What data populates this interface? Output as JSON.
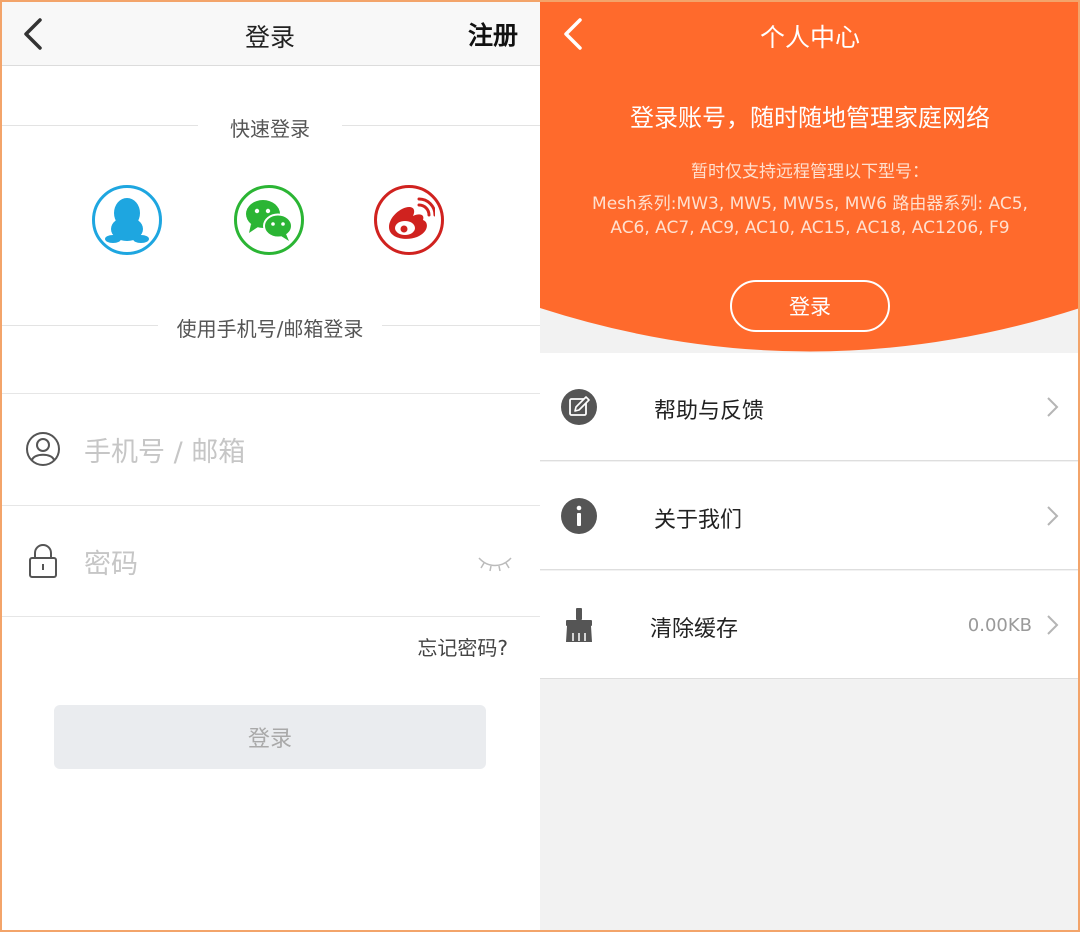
{
  "login_screen": {
    "title": "登录",
    "register_label": "注册",
    "quick_login_label": "快速登录",
    "social_icons": [
      "qq-icon",
      "wechat-icon",
      "weibo-icon"
    ],
    "phone_login_label": "使用手机号/邮箱登录",
    "phone_placeholder": "手机号 / 邮箱",
    "password_placeholder": "密码",
    "forgot_label": "忘记密码?",
    "login_button": "登录",
    "colors": {
      "qq": "#1ea6e0",
      "wechat": "#2bb534",
      "weibo": "#d0221f",
      "button_bg": "#eaecef"
    }
  },
  "profile_screen": {
    "title": "个人中心",
    "headline": "登录账号，随时随地管理家庭网络",
    "support_line1": "暂时仅支持远程管理以下型号：",
    "support_line2": "Mesh系列:MW3, MW5, MW5s, MW6 路由器系列: AC5,",
    "support_line3": "AC6, AC7, AC9, AC10, AC15, AC18, AC1206, F9",
    "login_button": "登录",
    "accent_color": "#ff6a2c",
    "menu": [
      {
        "label": "帮助与反馈",
        "icon": "edit-icon",
        "value": ""
      },
      {
        "label": "关于我们",
        "icon": "info-icon",
        "value": ""
      },
      {
        "label": "清除缓存",
        "icon": "broom-icon",
        "value": "0.00KB"
      }
    ]
  }
}
